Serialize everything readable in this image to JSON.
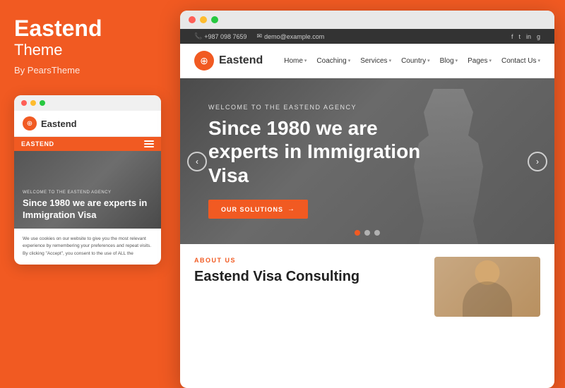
{
  "left_panel": {
    "brand": "Eastend",
    "subtitle": "Theme",
    "by": "By PearsTheme"
  },
  "mini_browser": {
    "logo": "Eastend",
    "nav_label": "EASTEND",
    "welcome": "WELCOME TO THE EASTEND AGENCY",
    "hero_title": "Since 1980 we are experts in Immigration Visa",
    "body_text": "We use cookies on our website to give you the most relevant experience by remembering your preferences and repeat visits. By clicking \"Accept\", you consent to the use of ALL the"
  },
  "site": {
    "topbar": {
      "phone": "+987 098 7659",
      "email": "demo@example.com",
      "social": [
        "f",
        "t",
        "in",
        "g"
      ]
    },
    "nav": {
      "logo": "Eastend",
      "links": [
        "Home",
        "Coaching",
        "Services",
        "Country",
        "Blog",
        "Pages",
        "Contact Us"
      ]
    },
    "hero": {
      "welcome": "WELCOME TO THE EASTEND AGENCY",
      "title": "Since 1980 we are experts in Immigration Visa",
      "cta": "OUR SOLUTIONS"
    },
    "below": {
      "about_label": "ABOUT US",
      "about_title": "Eastend Visa Consulting"
    }
  },
  "dots": [
    {
      "active": true
    },
    {
      "active": false
    },
    {
      "active": false
    }
  ]
}
